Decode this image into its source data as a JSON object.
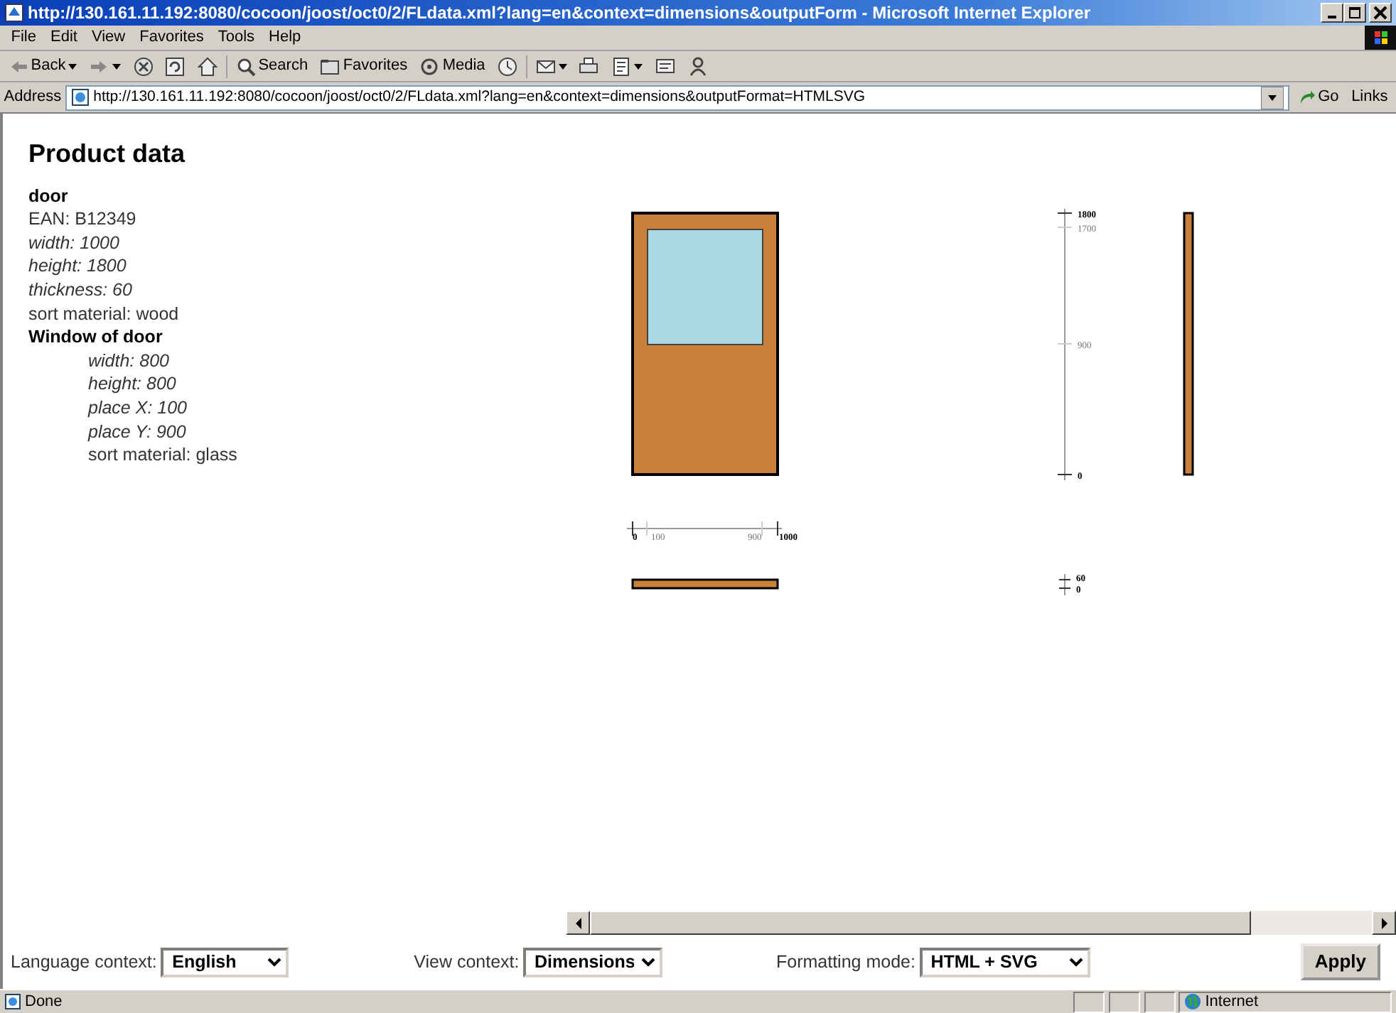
{
  "window": {
    "title": "http://130.161.11.192:8080/cocoon/joost/oct0/2/FLdata.xml?lang=en&context=dimensions&outputForm - Microsoft Internet Explorer"
  },
  "menu": [
    {
      "label": "File"
    },
    {
      "label": "Edit"
    },
    {
      "label": "View"
    },
    {
      "label": "Favorites"
    },
    {
      "label": "Tools"
    },
    {
      "label": "Help"
    }
  ],
  "toolbar": [
    {
      "kind": "back",
      "label": "Back",
      "dropdown": true
    },
    {
      "kind": "forward",
      "dropdown": true
    },
    {
      "kind": "stop",
      "dropdown": false
    },
    {
      "kind": "refresh",
      "dropdown": false
    },
    {
      "kind": "home",
      "dropdown": false
    },
    {
      "kind": "search",
      "label": "Search",
      "dropdown": false
    },
    {
      "kind": "favorites",
      "label": "Favorites",
      "dropdown": false
    },
    {
      "kind": "media",
      "label": "Media",
      "dropdown": false
    },
    {
      "kind": "history",
      "dropdown": false
    },
    {
      "kind": "mail",
      "dropdown": true
    },
    {
      "kind": "print",
      "dropdown": false
    },
    {
      "kind": "edit",
      "dropdown": true
    },
    {
      "kind": "discuss",
      "dropdown": false
    },
    {
      "kind": "messenger",
      "dropdown": false
    }
  ],
  "address": {
    "label": "Address",
    "url": "http://130.161.11.192:8080/cocoon/joost/oct0/2/FLdata.xml?lang=en&context=dimensions&outputFormat=HTMLSVG",
    "go": "Go",
    "links": "Links"
  },
  "page": {
    "heading": "Product data",
    "sections": [
      {
        "name": "door",
        "indented": false,
        "properties": [
          {
            "text": "EAN: B12349",
            "italic": false
          },
          {
            "text": "width: 1000",
            "italic": true
          },
          {
            "text": "height: 1800",
            "italic": true
          },
          {
            "text": "thickness: 60",
            "italic": true
          },
          {
            "text": "sort material: wood",
            "italic": false
          }
        ]
      },
      {
        "name": "Window of door",
        "indented": true,
        "properties": [
          {
            "text": "width: 800",
            "italic": true
          },
          {
            "text": "height: 800",
            "italic": true
          },
          {
            "text": "place X: 100",
            "italic": true
          },
          {
            "text": "place Y: 900",
            "italic": true
          },
          {
            "text": "sort material: glass",
            "italic": false
          }
        ]
      }
    ]
  },
  "drawings": {
    "height_ticks": [
      "1800",
      "1700",
      "900",
      "0"
    ],
    "width_ticks": [
      "0",
      "100",
      "900",
      "1000"
    ],
    "thickness_ticks": [
      "60",
      "0"
    ]
  },
  "form": {
    "fields": [
      {
        "label": "Language context:",
        "value": "English"
      },
      {
        "label": "View context:",
        "value": "Dimensions"
      },
      {
        "label": "Formatting mode:",
        "value": "HTML + SVG"
      }
    ],
    "apply": "Apply"
  },
  "status_bar": {
    "text": "Done",
    "zone": "Internet"
  }
}
